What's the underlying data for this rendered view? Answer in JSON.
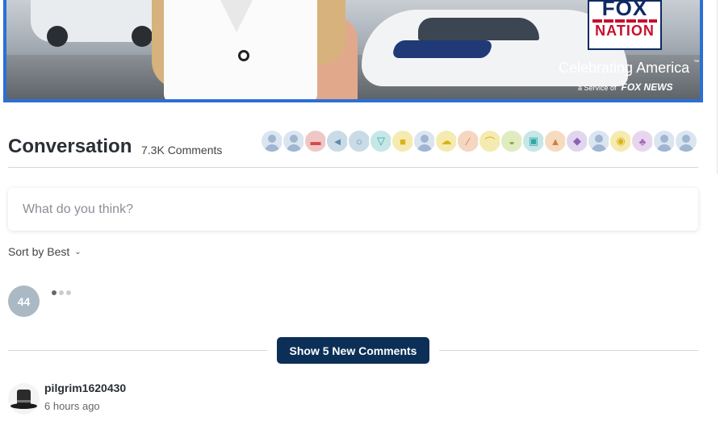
{
  "banner": {
    "logo_top": "FOX",
    "logo_bottom": "NATION",
    "tagline": "Celebrating America",
    "tagline_mark": "™",
    "service_prefix": "a Service of",
    "service_brand": "FOX NEWS",
    "colors": {
      "frame": "#2b6fd6",
      "logo_navy": "#0e2a63",
      "logo_red": "#c8102e"
    }
  },
  "conversation": {
    "title": "Conversation",
    "count": "7.3K Comments",
    "participant_avatars": [
      {
        "icon": "user-silhouette-icon",
        "bg": "#dbe5f0"
      },
      {
        "icon": "user-silhouette-icon",
        "bg": "#dbe5f0"
      },
      {
        "icon": "ticket-icon",
        "bg": "#f0c7c7"
      },
      {
        "icon": "paper-plane-icon",
        "bg": "#c9dbe6"
      },
      {
        "icon": "ring-icon",
        "bg": "#c9dbe6"
      },
      {
        "icon": "cocktail-icon",
        "bg": "#c7e6e6"
      },
      {
        "icon": "elephant-icon",
        "bg": "#f5ebb0"
      },
      {
        "icon": "user-silhouette-icon",
        "bg": "#dbe5f0"
      },
      {
        "icon": "cloud-icon",
        "bg": "#f5ebb0"
      },
      {
        "icon": "sword-icon",
        "bg": "#f5d6c0"
      },
      {
        "icon": "hammer-icon",
        "bg": "#f5ebb0"
      },
      {
        "icon": "duck-icon",
        "bg": "#e0ebc0"
      },
      {
        "icon": "shirt-icon",
        "bg": "#c7e6e6"
      },
      {
        "icon": "tent-icon",
        "bg": "#f5dcc0"
      },
      {
        "icon": "cube-icon",
        "bg": "#e2d6ef"
      },
      {
        "icon": "user-silhouette-icon",
        "bg": "#dbe5f0"
      },
      {
        "icon": "coin-icon",
        "bg": "#f5ebb0"
      },
      {
        "icon": "palm-tree-icon",
        "bg": "#e8d6ef"
      },
      {
        "icon": "user-silhouette-icon",
        "bg": "#dbe5f0"
      },
      {
        "icon": "user-silhouette-icon",
        "bg": "#dbe5f0"
      }
    ]
  },
  "composer": {
    "placeholder": "What do you think?"
  },
  "sort": {
    "label": "Sort by Best"
  },
  "loading": {
    "avatar_text": "44"
  },
  "new_comments": {
    "button_label": "Show 5 New Comments",
    "color": "#0b2f57"
  },
  "comments": [
    {
      "username": "pilgrim1620430",
      "time": "6 hours ago",
      "avatar_icon": "pilgrim-hat-icon"
    }
  ]
}
